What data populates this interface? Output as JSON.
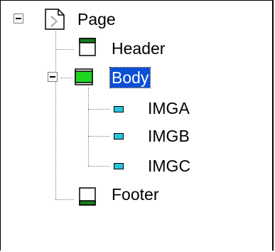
{
  "tree": {
    "root": {
      "label": "Page",
      "icon": "page-icon",
      "expanded": true,
      "children": [
        {
          "label": "Header",
          "icon": "header-icon"
        },
        {
          "label": "Body",
          "icon": "body-icon",
          "expanded": true,
          "selected": true,
          "children": [
            {
              "label": "IMGA",
              "icon": "image-icon"
            },
            {
              "label": "IMGB",
              "icon": "image-icon"
            },
            {
              "label": "IMGC",
              "icon": "image-icon"
            }
          ]
        },
        {
          "label": "Footer",
          "icon": "footer-icon"
        }
      ]
    }
  },
  "colors": {
    "selection": "#0a4fd6",
    "header_footer_bar": "#1a7a1a",
    "body_fill": "#1ed41e",
    "image_fill": "#29c4dc",
    "connector": "#808080"
  }
}
